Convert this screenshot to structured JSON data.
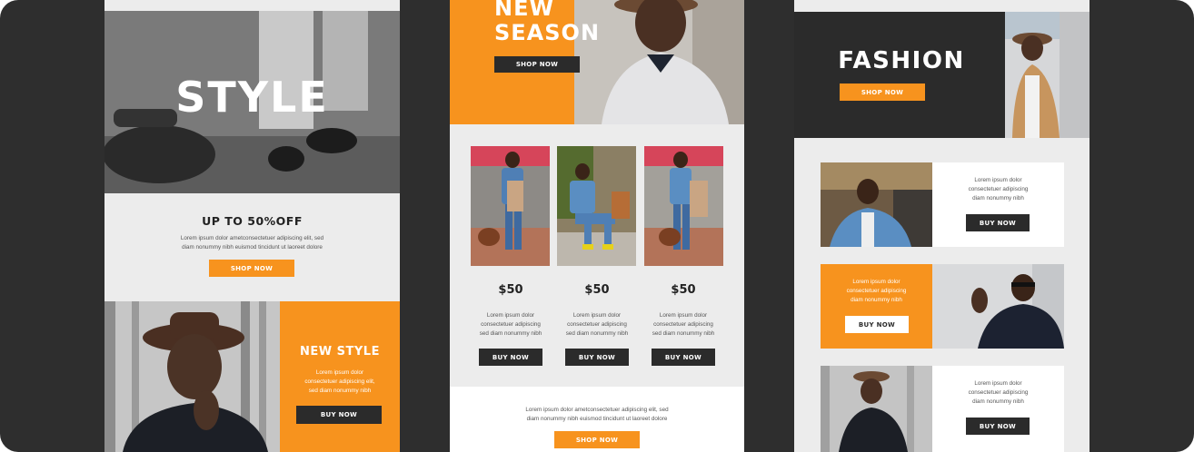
{
  "colors": {
    "orange": "#f7931e",
    "dark": "#2b2b2b",
    "background": "#2e2e2e",
    "panel": "#ececec"
  },
  "panel1": {
    "hero_title": "STYLE",
    "promo_heading": "UP TO 50%OFF",
    "promo_text_line1": "Lorem ipsum dolor ametconsectetuer adipiscing elit, sed",
    "promo_text_line2": "diam nonummy nibh euismod tincidunt ut laoreet dolore",
    "promo_button": "SHOP NOW",
    "new_style_heading": "NEW STYLE",
    "new_style_line1": "Lorem ipsum dolor",
    "new_style_line2": "consectetuer adipiscing elit,",
    "new_style_line3": "sed diam nonummy nibh",
    "new_style_button": "BUY NOW"
  },
  "panel2": {
    "hero_title_line1": "NEW",
    "hero_title_line2": "SEASON",
    "hero_button": "SHOP NOW",
    "products": [
      {
        "price": "$50",
        "line1": "Lorem ipsum dolor",
        "line2": "consectetuer adipiscing",
        "line3": "sed diam nonummy nibh",
        "button": "BUY NOW"
      },
      {
        "price": "$50",
        "line1": "Lorem ipsum dolor",
        "line2": "consectetuer adipiscing",
        "line3": "sed diam nonummy nibh",
        "button": "BUY NOW"
      },
      {
        "price": "$50",
        "line1": "Lorem ipsum dolor",
        "line2": "consectetuer adipiscing",
        "line3": "sed diam nonummy nibh",
        "button": "BUY NOW"
      }
    ],
    "footer_line1": "Lorem ipsum dolor ametconsectetuer adipiscing elit, sed",
    "footer_line2": "diam nonummy nibh euismod tincidunt ut laoreet dolore",
    "footer_button": "SHOP NOW"
  },
  "panel3": {
    "hero_title": "FASHION",
    "hero_button": "SHOP NOW",
    "rows": [
      {
        "line1": "Lorem ipsum dolor",
        "line2": "consectetuer adipiscing",
        "line3": "diam nonummy nibh",
        "button": "BUY NOW"
      },
      {
        "line1": "Lorem ipsum dolor",
        "line2": "consectetuer adipiscing",
        "line3": "diam nonummy nibh",
        "button": "BUY NOW"
      },
      {
        "line1": "Lorem ipsum dolor",
        "line2": "consectetuer adipiscing",
        "line3": "diam nonummy nibh",
        "button": "BUY NOW"
      }
    ]
  }
}
